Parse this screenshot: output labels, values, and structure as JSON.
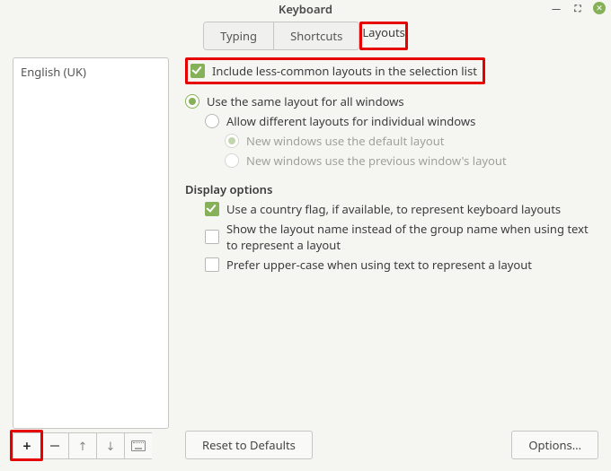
{
  "window": {
    "title": "Keyboard"
  },
  "tabs": {
    "typing": "Typing",
    "shortcuts": "Shortcuts",
    "layouts": "Layouts"
  },
  "layouts_list": {
    "item0": "English (UK)"
  },
  "options": {
    "include_less_common": "Include less-common layouts in the selection list",
    "same_layout_all": "Use the same layout for all windows",
    "diff_layout_each": "Allow different layouts for individual windows",
    "new_default": "New windows use the default layout",
    "new_previous": "New windows use the previous window's layout"
  },
  "display": {
    "heading": "Display options",
    "country_flag": "Use a country flag, if available,  to represent keyboard layouts",
    "layout_name": "Show the layout name instead of the group name when using text to represent a layout",
    "upper_case": "Prefer upper-case when using text to represent a layout"
  },
  "buttons": {
    "reset": "Reset to Defaults",
    "options": "Options…"
  }
}
